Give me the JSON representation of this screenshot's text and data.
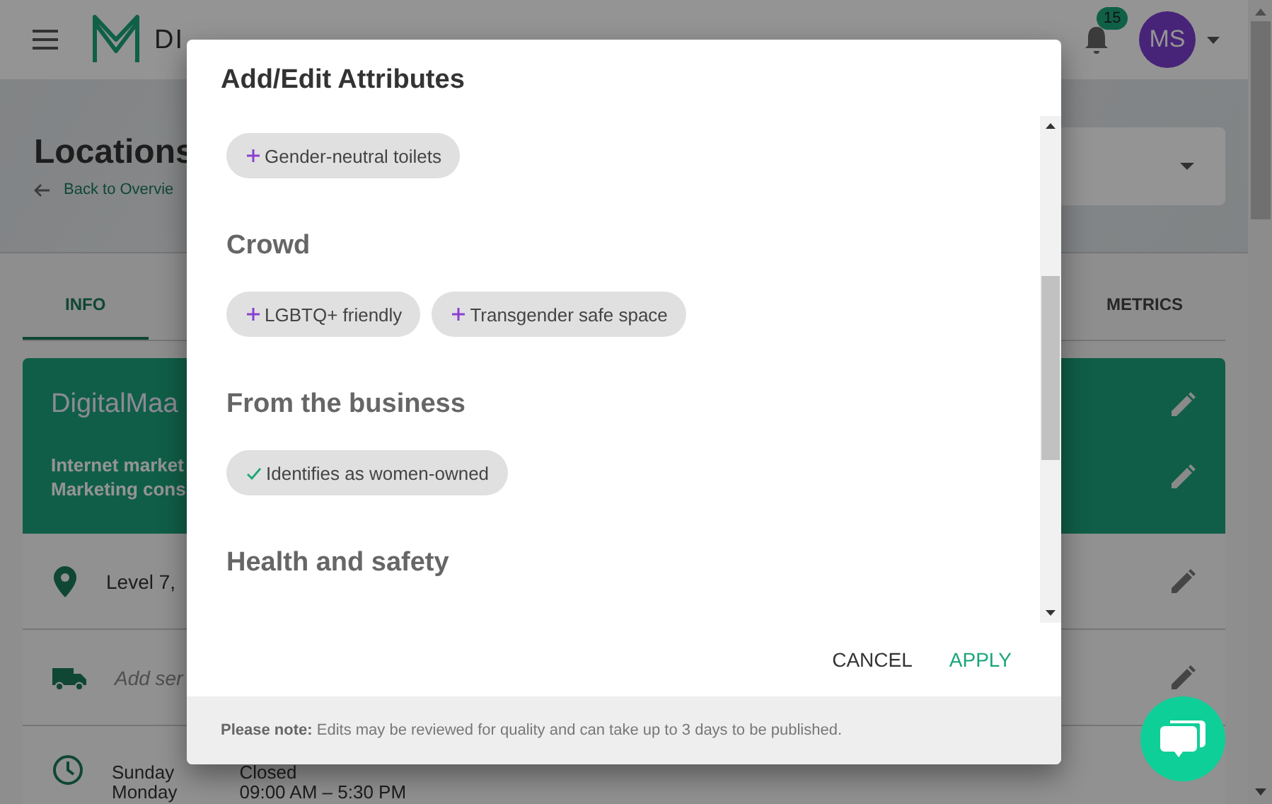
{
  "header": {
    "brand": "DI",
    "notification_count": "15",
    "avatar": "MS"
  },
  "page": {
    "title": "Locations",
    "back_link": "Back to Overvie"
  },
  "tabs": [
    {
      "label": "INFO",
      "selected": true
    },
    {
      "label": "METRICS",
      "selected": false
    }
  ],
  "business_card": {
    "name": "DigitalMaa",
    "categories": [
      "Internet market",
      "Marketing cons"
    ]
  },
  "info_rows": [
    {
      "kind": "address",
      "text": "Level 7,"
    },
    {
      "kind": "services",
      "text": "Add ser"
    },
    {
      "kind": "hours",
      "days": [
        "Sunday",
        "Monday"
      ],
      "times": [
        "Closed",
        "09:00 AM – 5:30 PM"
      ]
    }
  ],
  "dialog": {
    "title": "Add/Edit Attributes",
    "sections": [
      {
        "chips": [
          {
            "label": "Gender-neutral toilets",
            "selected": false
          }
        ]
      },
      {
        "heading": "Crowd",
        "chips": [
          {
            "label": "LGBTQ+ friendly",
            "selected": false
          },
          {
            "label": "Transgender safe space",
            "selected": false
          }
        ]
      },
      {
        "heading": "From the business",
        "chips": [
          {
            "label": "Identifies as women-owned",
            "selected": true
          }
        ]
      },
      {
        "heading": "Health and safety"
      }
    ],
    "buttons": [
      {
        "label": "CANCEL",
        "kind": "secondary"
      },
      {
        "label": "APPLY",
        "kind": "primary"
      }
    ],
    "note": "**Please note:** Edits may be reviewed for quality and can take up to 3 days to be published."
  }
}
